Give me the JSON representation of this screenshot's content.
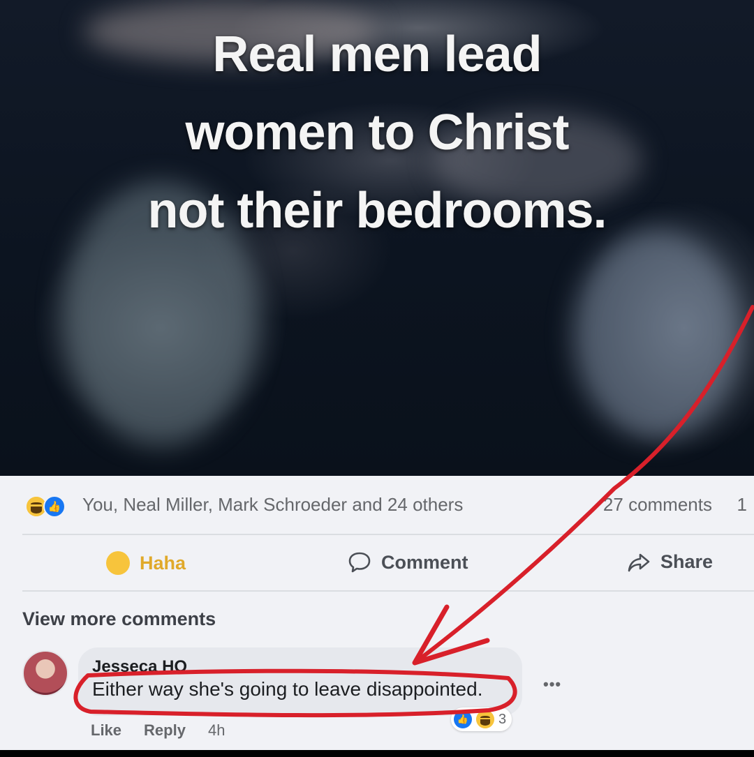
{
  "post": {
    "image_text": [
      "Real men lead",
      "women to Christ",
      "not their bedrooms."
    ]
  },
  "reactions": {
    "icons": [
      "haha-icon",
      "like-icon"
    ],
    "names": "You, Neal Miller, Mark Schroeder and 24 others",
    "comments_count": "27 comments",
    "shares_count": "1"
  },
  "actions": {
    "haha_label": "Haha",
    "comment_label": "Comment",
    "share_label": "Share"
  },
  "comments": {
    "view_more": "View more comments",
    "items": [
      {
        "author": "Jesseca HO",
        "text": "Either way she's going to leave disappointed.",
        "reaction_count": "3",
        "like_label": "Like",
        "reply_label": "Reply",
        "time": "4h"
      }
    ]
  },
  "colors": {
    "like_blue": "#1877f2",
    "haha_yellow": "#f7c43c",
    "annotation_red": "#d8202a"
  }
}
